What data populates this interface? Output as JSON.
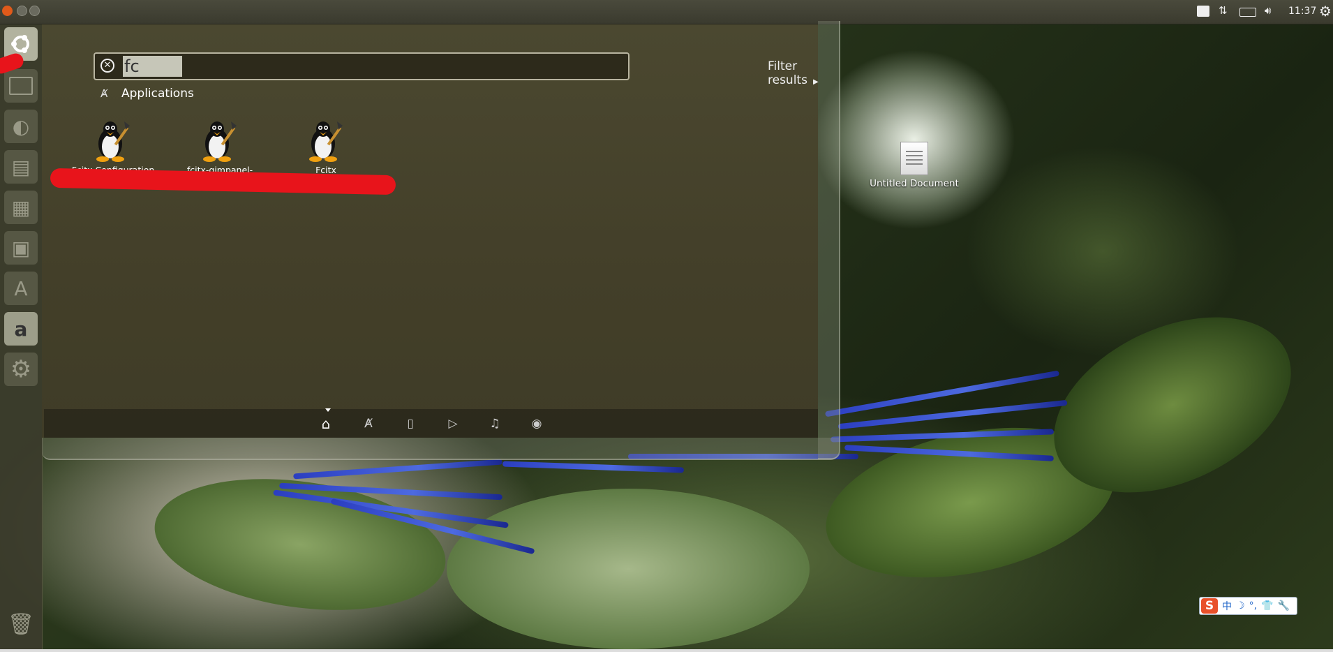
{
  "top_panel": {
    "clock": "11:37",
    "tray_icons": [
      "notification-icon",
      "network-icon",
      "battery-icon",
      "volume-icon",
      "settings-gear-icon"
    ]
  },
  "launcher": {
    "items": [
      {
        "name": "dash-home",
        "icon": "ubuntu-logo-icon"
      },
      {
        "name": "files",
        "icon": "folder-icon"
      },
      {
        "name": "firefox",
        "icon": "firefox-icon"
      },
      {
        "name": "writer",
        "icon": "writer-icon"
      },
      {
        "name": "calc",
        "icon": "calc-icon"
      },
      {
        "name": "impress",
        "icon": "impress-icon"
      },
      {
        "name": "software-center",
        "icon": "software-center-icon",
        "glyph": "A"
      },
      {
        "name": "amazon",
        "icon": "amazon-icon",
        "glyph": "a"
      },
      {
        "name": "system-settings",
        "icon": "gear-icon"
      },
      {
        "name": "trash",
        "icon": "trash-icon"
      }
    ]
  },
  "dash": {
    "search_value": "fc",
    "filter_results": "Filter results",
    "category": "Applications",
    "apps": [
      {
        "label": "Fcitx Configuration"
      },
      {
        "label": "fcitx-qimpanel-configtool"
      },
      {
        "label": "Fcitx"
      }
    ],
    "lenses": [
      "home-lens-icon",
      "applications-lens-icon",
      "files-lens-icon",
      "video-lens-icon",
      "music-lens-icon",
      "photo-lens-icon"
    ]
  },
  "desktop": {
    "document_label": "Untitled Document"
  },
  "ime_bar": {
    "logo": "S",
    "items": [
      "中",
      "☽",
      "°,",
      "👕",
      "🔧"
    ]
  },
  "colors": {
    "accent": "#e05a1a",
    "annotation": "#e8141b",
    "ime_blue": "#1e64c8"
  }
}
